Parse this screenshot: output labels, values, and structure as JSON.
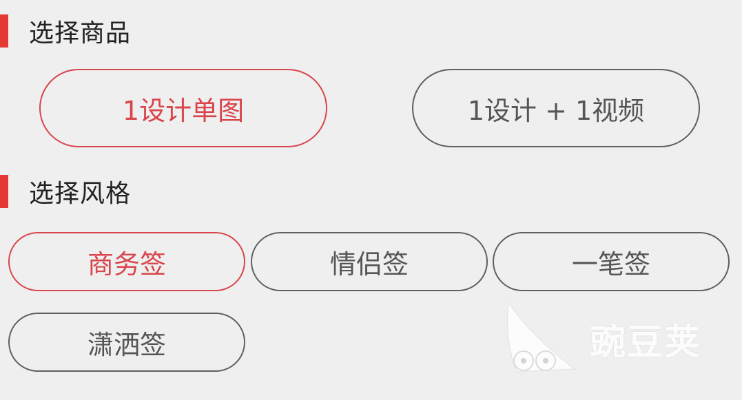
{
  "product_section": {
    "title": "选择商品",
    "options": [
      {
        "label": "1设计单图",
        "selected": true
      },
      {
        "label": "1设计 + 1视频",
        "selected": false
      }
    ]
  },
  "style_section": {
    "title": "选择风格",
    "options": [
      {
        "label": "商务签",
        "selected": true
      },
      {
        "label": "情侣签",
        "selected": false
      },
      {
        "label": "一笔签",
        "selected": false
      },
      {
        "label": "潇洒签",
        "selected": false
      }
    ]
  },
  "watermark": {
    "text": "豌豆荚",
    "icon": "wandoujia-logo-icon"
  },
  "colors": {
    "accent": "#e53935",
    "selected": "#d8454b",
    "unselected": "#5f5f5f",
    "background": "#efefef"
  }
}
